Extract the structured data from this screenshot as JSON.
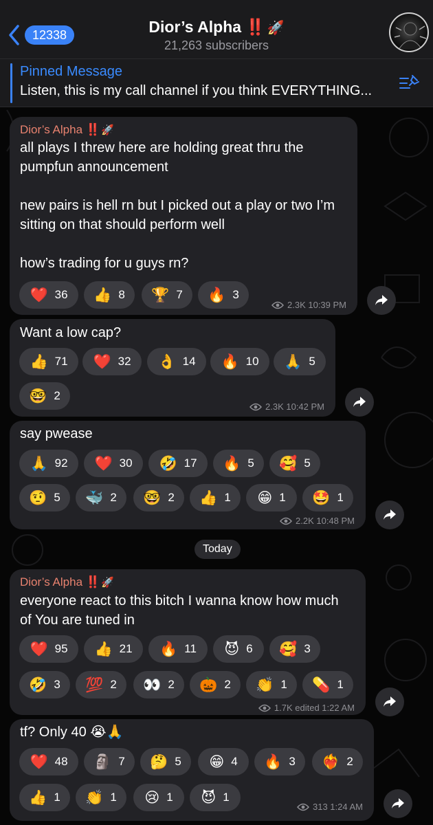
{
  "header": {
    "back_count": "12338",
    "title": "Dior’s Alpha",
    "title_bang": "‼️",
    "title_rocket": "🚀",
    "subscribers": "21,263 subscribers"
  },
  "pinned": {
    "label": "Pinned Message",
    "text": "Listen, this is my call channel if you think EVERYTHING..."
  },
  "date_divider": "Today",
  "messages": [
    {
      "sender": "Dior’s Alpha",
      "sender_bang": "‼️",
      "sender_rocket": "🚀",
      "text": "all plays I threw here are holding great thru the pumpfun announcement\n\nnew pairs is hell rn but I picked out a play or two I’m sitting on that should perform well\n\nhow’s trading for u guys rn?",
      "reactions": [
        {
          "emoji": "❤️",
          "icon": "heart",
          "count": "36"
        },
        {
          "emoji": "👍",
          "icon": "thumbs-up",
          "count": "8"
        },
        {
          "emoji": "🏆",
          "icon": "trophy",
          "count": "7"
        },
        {
          "emoji": "🔥",
          "icon": "fire",
          "count": "3"
        }
      ],
      "meta": "2.3K 10:39 PM"
    },
    {
      "text": "Want a low cap?",
      "reactions": [
        {
          "emoji": "👍",
          "icon": "thumbs-up",
          "count": "71"
        },
        {
          "emoji": "❤️",
          "icon": "heart",
          "count": "32"
        },
        {
          "emoji": "👌",
          "icon": "ok-hand",
          "count": "14"
        },
        {
          "emoji": "🔥",
          "icon": "fire",
          "count": "10"
        },
        {
          "emoji": "🙏",
          "icon": "pray",
          "count": "5"
        },
        {
          "emoji": "🤓",
          "icon": "nerd-face",
          "count": "2"
        }
      ],
      "meta": "2.3K 10:42 PM"
    },
    {
      "text": "say pwease",
      "reactions": [
        {
          "emoji": "🙏",
          "icon": "pray",
          "count": "92"
        },
        {
          "emoji": "❤️",
          "icon": "heart",
          "count": "30"
        },
        {
          "emoji": "🤣",
          "icon": "rofl",
          "count": "17"
        },
        {
          "emoji": "🔥",
          "icon": "fire",
          "count": "5"
        },
        {
          "emoji": "🥰",
          "icon": "smiling-hearts",
          "count": "5"
        },
        {
          "emoji": "🤨",
          "icon": "raised-eyebrow",
          "count": "5"
        },
        {
          "emoji": "🐳",
          "icon": "whale",
          "count": "2"
        },
        {
          "emoji": "🤓",
          "icon": "nerd-face",
          "count": "2"
        },
        {
          "emoji": "👍",
          "icon": "thumbs-up",
          "count": "1"
        },
        {
          "emoji": "😁",
          "icon": "grin",
          "count": "1"
        },
        {
          "emoji": "🤩",
          "icon": "star-struck",
          "count": "1"
        }
      ],
      "meta": "2.2K 10:48 PM"
    },
    {
      "sender": "Dior’s Alpha",
      "sender_bang": "‼️",
      "sender_rocket": "🚀",
      "text": "everyone react to this bitch I wanna know how much of You are tuned in",
      "reactions": [
        {
          "emoji": "❤️",
          "icon": "heart",
          "count": "95"
        },
        {
          "emoji": "👍",
          "icon": "thumbs-up",
          "count": "21"
        },
        {
          "emoji": "🔥",
          "icon": "fire",
          "count": "11"
        },
        {
          "emoji": "😈",
          "icon": "devil",
          "count": "6"
        },
        {
          "emoji": "🥰",
          "icon": "smiling-hearts",
          "count": "3"
        },
        {
          "emoji": "🤣",
          "icon": "rofl",
          "count": "3"
        },
        {
          "emoji": "💯",
          "icon": "hundred",
          "count": "2"
        },
        {
          "emoji": "👀",
          "icon": "eyes",
          "count": "2"
        },
        {
          "emoji": "🎃",
          "icon": "pumpkin",
          "count": "2"
        },
        {
          "emoji": "👏",
          "icon": "clap",
          "count": "1"
        },
        {
          "emoji": "💊",
          "icon": "pill",
          "count": "1"
        }
      ],
      "meta": "1.7K edited 1:22 AM"
    },
    {
      "text": "tf? Only 40 😭🙏",
      "reactions": [
        {
          "emoji": "❤️",
          "icon": "heart",
          "count": "48"
        },
        {
          "emoji": "🗿",
          "icon": "moai",
          "count": "7"
        },
        {
          "emoji": "🤔",
          "icon": "thinking",
          "count": "5"
        },
        {
          "emoji": "😁",
          "icon": "grin",
          "count": "4"
        },
        {
          "emoji": "🔥",
          "icon": "fire",
          "count": "3"
        },
        {
          "emoji": "❤️‍🔥",
          "icon": "heart-on-fire",
          "count": "2"
        },
        {
          "emoji": "👍",
          "icon": "thumbs-up",
          "count": "1"
        },
        {
          "emoji": "👏",
          "icon": "clap",
          "count": "1"
        },
        {
          "emoji": "😢",
          "icon": "crying",
          "count": "1"
        },
        {
          "emoji": "😈",
          "icon": "devil",
          "count": "1"
        }
      ],
      "meta": "313 1:24 AM"
    }
  ]
}
